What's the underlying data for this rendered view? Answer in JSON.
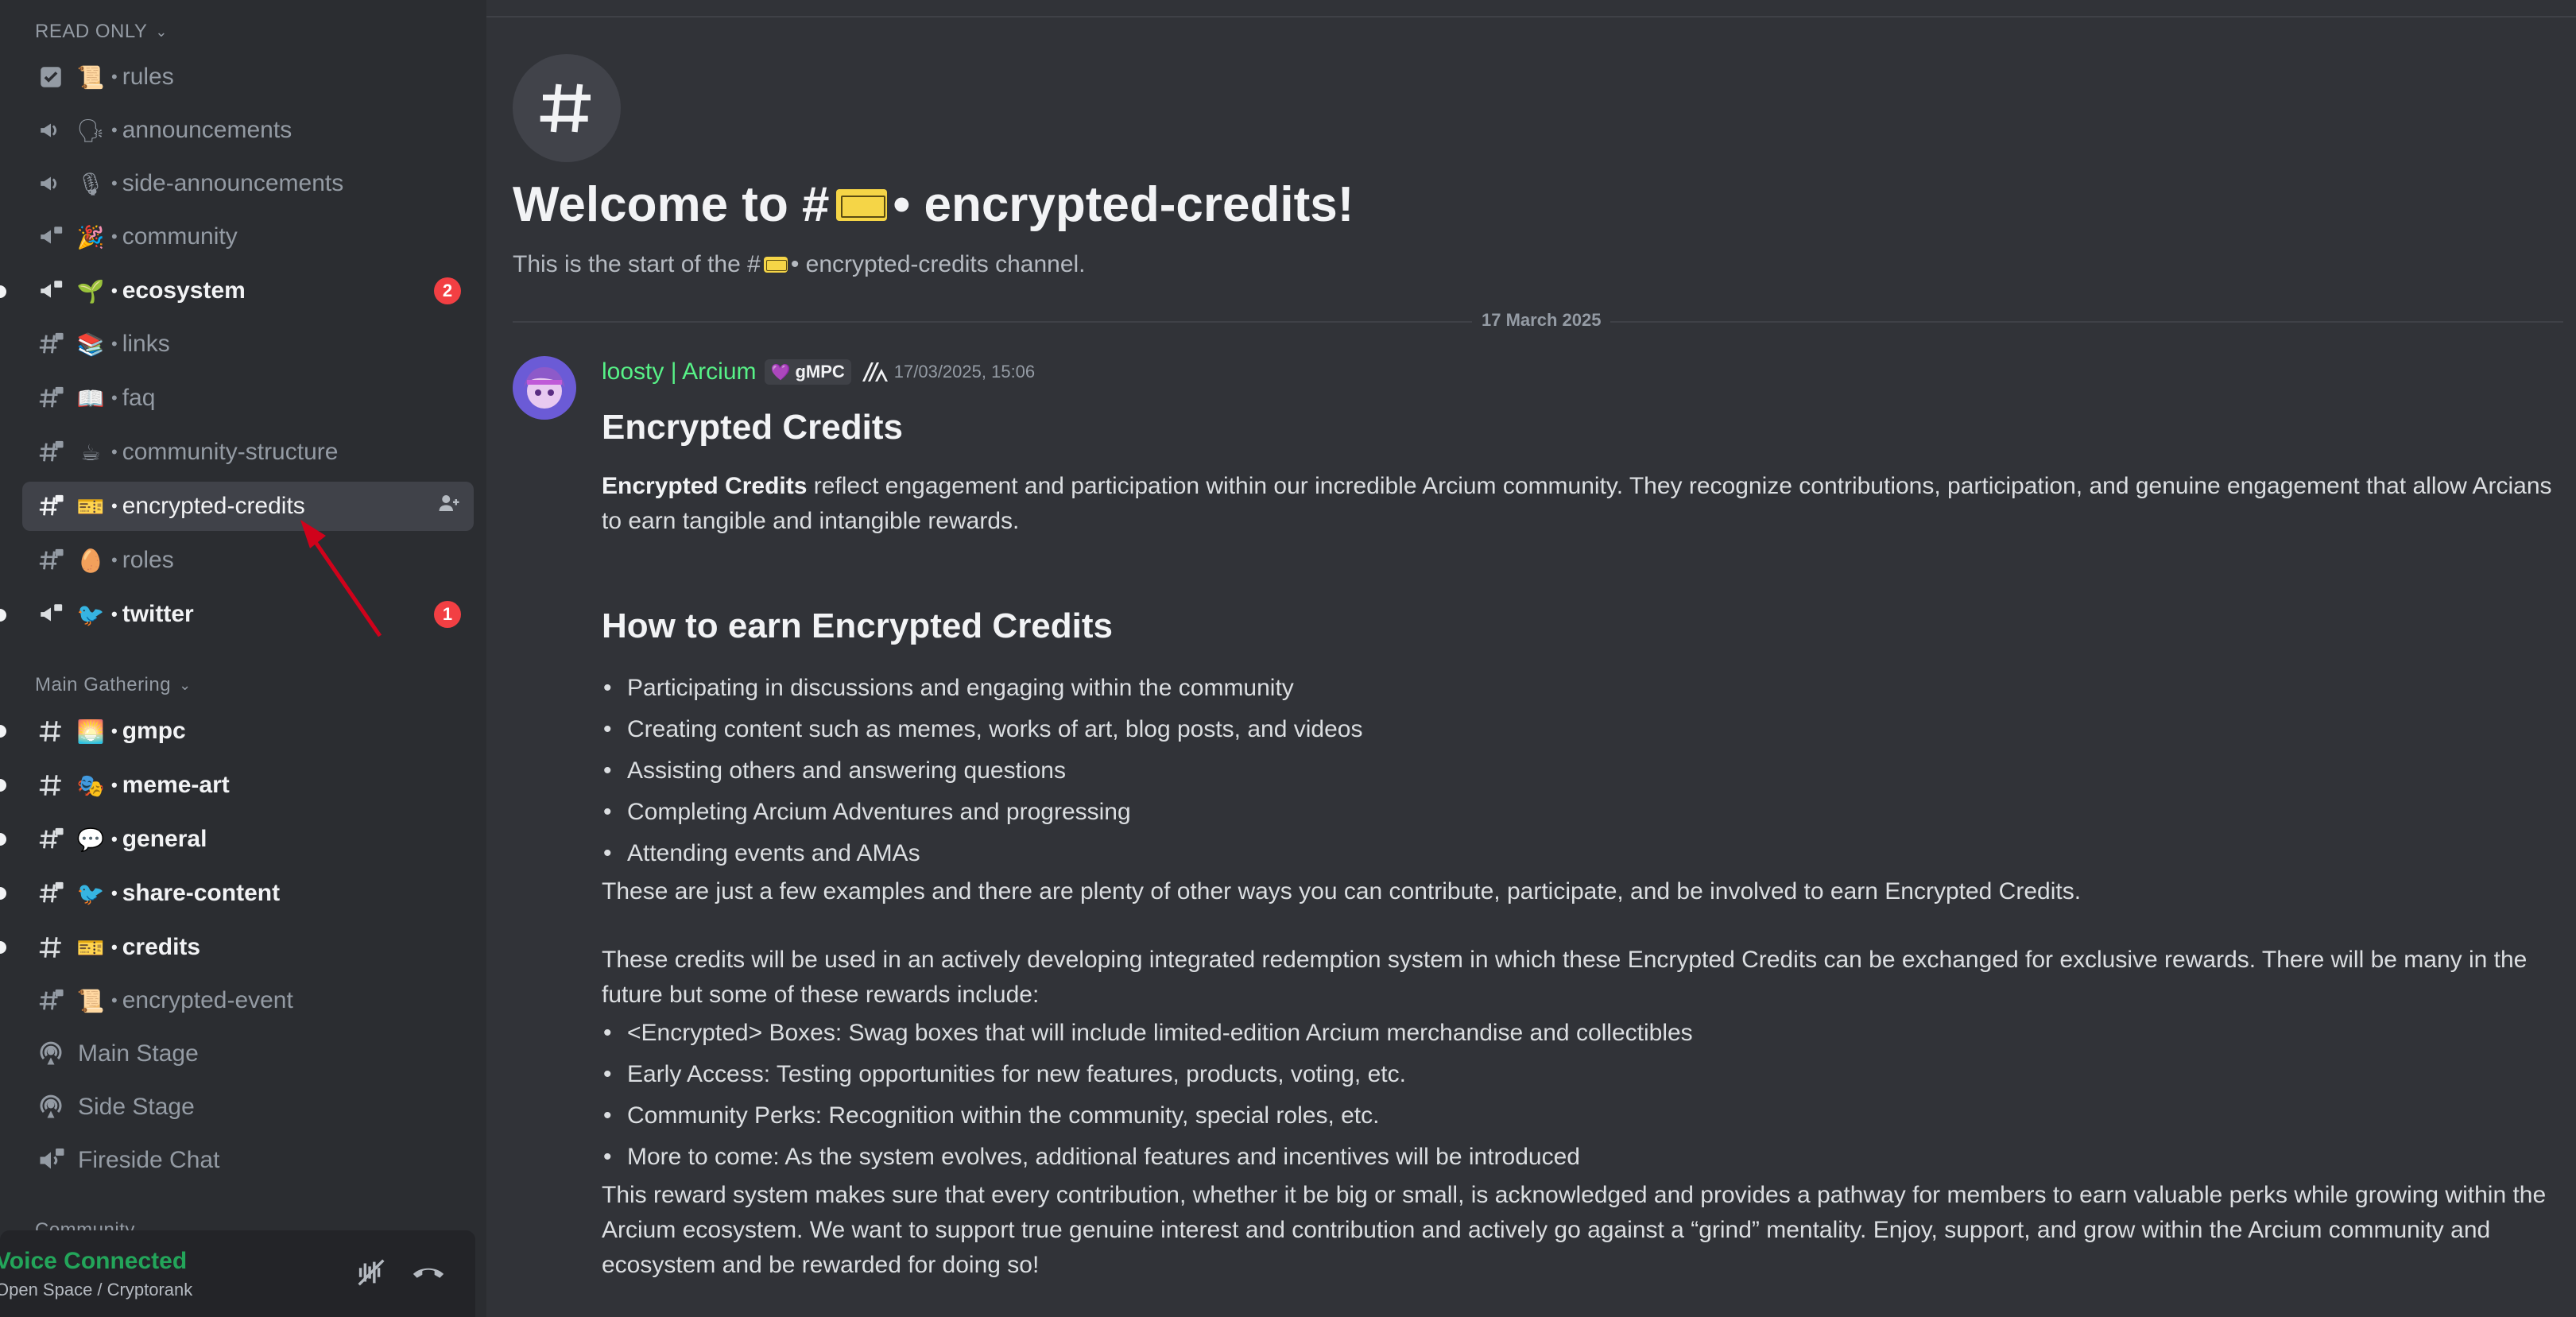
{
  "sidebar": {
    "read_only_header": "READ ONLY",
    "main_gathering_header": "Main Gathering",
    "community_header": "Community",
    "read_only_channels": [
      {
        "emoji": "📜",
        "name": "rules",
        "icon": "rules-icon"
      },
      {
        "emoji": "🗣",
        "name": "announcements",
        "icon": "megaphone-icon"
      },
      {
        "emoji": "🎙",
        "name": "side-announcements",
        "icon": "megaphone-icon"
      },
      {
        "emoji": "🎉",
        "name": "community",
        "icon": "megaphone-lock-icon"
      },
      {
        "emoji": "🌱",
        "name": "ecosystem",
        "icon": "megaphone-lock-icon",
        "badge": "2"
      },
      {
        "emoji": "📚",
        "name": "links",
        "icon": "hash-lock-icon"
      },
      {
        "emoji": "📖",
        "name": "faq",
        "icon": "hash-lock-icon"
      },
      {
        "emoji": "☕",
        "name": "community-structure",
        "icon": "hash-lock-icon"
      },
      {
        "emoji": "🎫",
        "name": "encrypted-credits",
        "icon": "hash-lock-icon"
      },
      {
        "emoji": "🥚",
        "name": "roles",
        "icon": "hash-lock-icon"
      },
      {
        "emoji": "🐦",
        "name": "twitter",
        "icon": "megaphone-lock-icon",
        "badge": "1"
      }
    ],
    "main_channels": [
      {
        "emoji": "🌅",
        "name": "gmpc",
        "icon": "hash-icon"
      },
      {
        "emoji": "🎭",
        "name": "meme-art",
        "icon": "hash-icon"
      },
      {
        "emoji": "💬",
        "name": "general",
        "icon": "hash-lock-icon"
      },
      {
        "emoji": "🐦",
        "name": "share-content",
        "icon": "hash-lock-icon"
      },
      {
        "emoji": "🎫",
        "name": "credits",
        "icon": "hash-icon"
      },
      {
        "emoji": "📜",
        "name": "encrypted-event",
        "icon": "hash-lock-icon"
      }
    ],
    "stages": [
      "Main Stage",
      "Side Stage",
      "Fireside Chat"
    ],
    "voice": {
      "status": "Voice Connected",
      "channel": "Open Space / Cryptorank"
    }
  },
  "main": {
    "welcome_prefix": "Welcome to #",
    "welcome_suffix": " • encrypted-credits!",
    "start_prefix": "This is the start of the #",
    "start_suffix": " • encrypted-credits channel.",
    "date_divider": "17 March 2025",
    "message": {
      "author": "loosty | Arcium",
      "role_tag": "gMPC",
      "timestamp": "17/03/2025, 15:06",
      "heading1": "Encrypted Credits",
      "intro_bold": "Encrypted Credits",
      "intro_rest": " reflect engagement and participation within our incredible Arcium community. They recognize contributions, participation, and genuine engagement that allow Arcians to earn tangible and intangible rewards.",
      "heading2": "How to earn Encrypted Credits",
      "earn_list": [
        "Participating in discussions and engaging within the community",
        "Creating content such as memes, works of art, blog posts, and videos",
        "Assisting others and answering questions",
        "Completing Arcium Adventures and progressing",
        "Attending events and AMAs"
      ],
      "examples_text": "These are just a few examples and there are plenty of other ways you can contribute, participate, and be involved to earn Encrypted Credits.",
      "redemption_text": "These credits will be used in an actively developing integrated redemption system in which these Encrypted Credits can be exchanged for exclusive rewards. There will be many in the future but some of these rewards include:",
      "rewards_list": [
        "<Encrypted> Boxes: Swag boxes that will include limited-edition Arcium merchandise and collectibles",
        "Early Access: Testing opportunities for new features, products, voting, etc.",
        "Community Perks: Recognition within the community, special roles, etc.",
        "More to come: As the system evolves, additional features and incentives will be introduced"
      ],
      "closing_text": "This reward system makes sure that every contribution, whether it be big or small, is acknowledged and provides a pathway for members to earn valuable perks while growing within the Arcium ecosystem. We want to support true genuine interest and contribution and actively go against a “grind” mentality. Enjoy, support, and grow within the Arcium community and ecosystem and be rewarded for doing so!"
    }
  },
  "colors": {
    "sidebar_bg": "#2b2d31",
    "main_bg": "#313338",
    "selected_bg": "#404249",
    "author_green": "#57f287",
    "voice_green": "#23a55a",
    "badge_red": "#f23f43",
    "arrow_red": "#d0021b"
  }
}
